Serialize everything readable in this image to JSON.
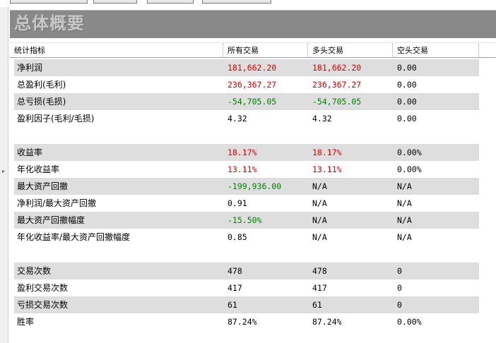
{
  "header": {
    "title": "总体概要"
  },
  "columns": [
    "统计指标",
    "所有交易",
    "多头交易",
    "空头交易"
  ],
  "rows": [
    {
      "label": "净利润",
      "all": "181,662.20",
      "long": "181,662.20",
      "short": "0.00",
      "all_c": "pos",
      "long_c": "pos",
      "short_c": "neu"
    },
    {
      "label": "总盈利(毛利)",
      "all": "236,367.27",
      "long": "236,367.27",
      "short": "0.00",
      "all_c": "pos",
      "long_c": "pos",
      "short_c": "neu"
    },
    {
      "label": "总亏损(毛损)",
      "all": "-54,705.05",
      "long": "-54,705.05",
      "short": "0.00",
      "all_c": "neg",
      "long_c": "neg",
      "short_c": "neu"
    },
    {
      "label": "盈利因子(毛利/毛损)",
      "all": "4.32",
      "long": "4.32",
      "short": "0.00",
      "all_c": "neu",
      "long_c": "neu",
      "short_c": "neu"
    },
    {
      "label": "收益率",
      "all": "18.17%",
      "long": "18.17%",
      "short": "0.00%",
      "all_c": "pos",
      "long_c": "pos",
      "short_c": "neu"
    },
    {
      "label": "年化收益率",
      "all": "13.11%",
      "long": "13.11%",
      "short": "0.00%",
      "all_c": "pos",
      "long_c": "pos",
      "short_c": "neu"
    },
    {
      "label": "最大资产回撤",
      "all": "-199,936.00",
      "long": "N/A",
      "short": "N/A",
      "all_c": "neg",
      "long_c": "neu",
      "short_c": "neu"
    },
    {
      "label": "净利润/最大资产回撤",
      "all": "0.91",
      "long": "N/A",
      "short": "N/A",
      "all_c": "neu",
      "long_c": "neu",
      "short_c": "neu"
    },
    {
      "label": "最大资产回撤幅度",
      "all": "-15.50%",
      "long": "N/A",
      "short": "N/A",
      "all_c": "neg",
      "long_c": "neu",
      "short_c": "neu"
    },
    {
      "label": "年化收益率/最大资产回撤幅度",
      "all": "0.85",
      "long": "N/A",
      "short": "N/A",
      "all_c": "neu",
      "long_c": "neu",
      "short_c": "neu"
    },
    {
      "label": "交易次数",
      "all": "478",
      "long": "478",
      "short": "0",
      "all_c": "neu",
      "long_c": "neu",
      "short_c": "neu"
    },
    {
      "label": "盈利交易次数",
      "all": "417",
      "long": "417",
      "short": "0",
      "all_c": "neu",
      "long_c": "neu",
      "short_c": "neu"
    },
    {
      "label": "亏损交易次数",
      "all": "61",
      "long": "61",
      "short": "0",
      "all_c": "neu",
      "long_c": "neu",
      "short_c": "neu"
    },
    {
      "label": "胜率",
      "all": "87.24%",
      "long": "87.24%",
      "short": "0.00%",
      "all_c": "neu",
      "long_c": "neu",
      "short_c": "neu"
    }
  ],
  "colors": {
    "positive": "#e00000",
    "negative": "#008000",
    "header_bg": "#898989",
    "row_shade": "#dedede"
  }
}
